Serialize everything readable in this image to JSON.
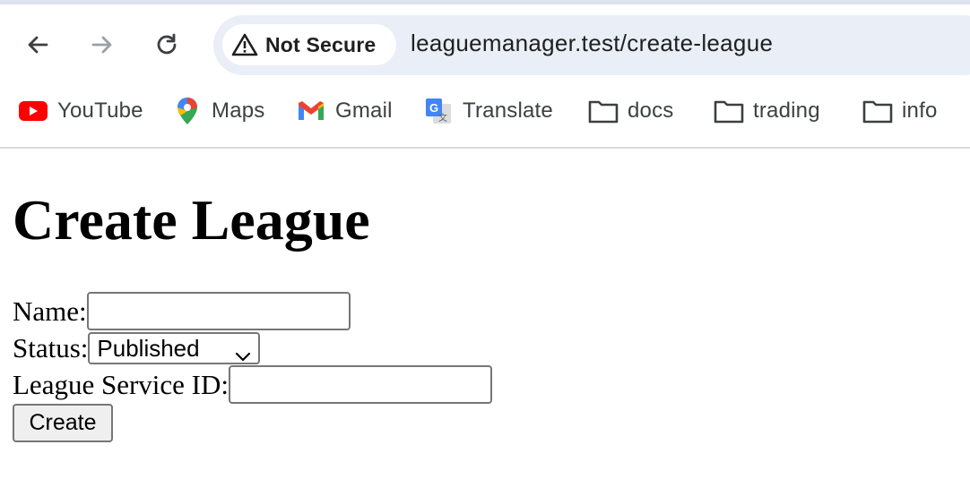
{
  "browser": {
    "security_label": "Not Secure",
    "url": "leaguemanager.test/create-league",
    "bookmarks": [
      {
        "label": "YouTube",
        "icon": "youtube-icon"
      },
      {
        "label": "Maps",
        "icon": "maps-icon"
      },
      {
        "label": "Gmail",
        "icon": "gmail-icon"
      },
      {
        "label": "Translate",
        "icon": "translate-icon"
      },
      {
        "label": "docs",
        "icon": "folder-icon"
      },
      {
        "label": "trading",
        "icon": "folder-icon"
      },
      {
        "label": "info",
        "icon": "folder-icon"
      }
    ]
  },
  "page": {
    "title": "Create League",
    "form": {
      "name_label": "Name:",
      "name_value": "",
      "status_label": "Status:",
      "status_selected": "Published",
      "service_id_label": "League Service ID:",
      "service_id_value": "",
      "submit_label": "Create"
    }
  }
}
